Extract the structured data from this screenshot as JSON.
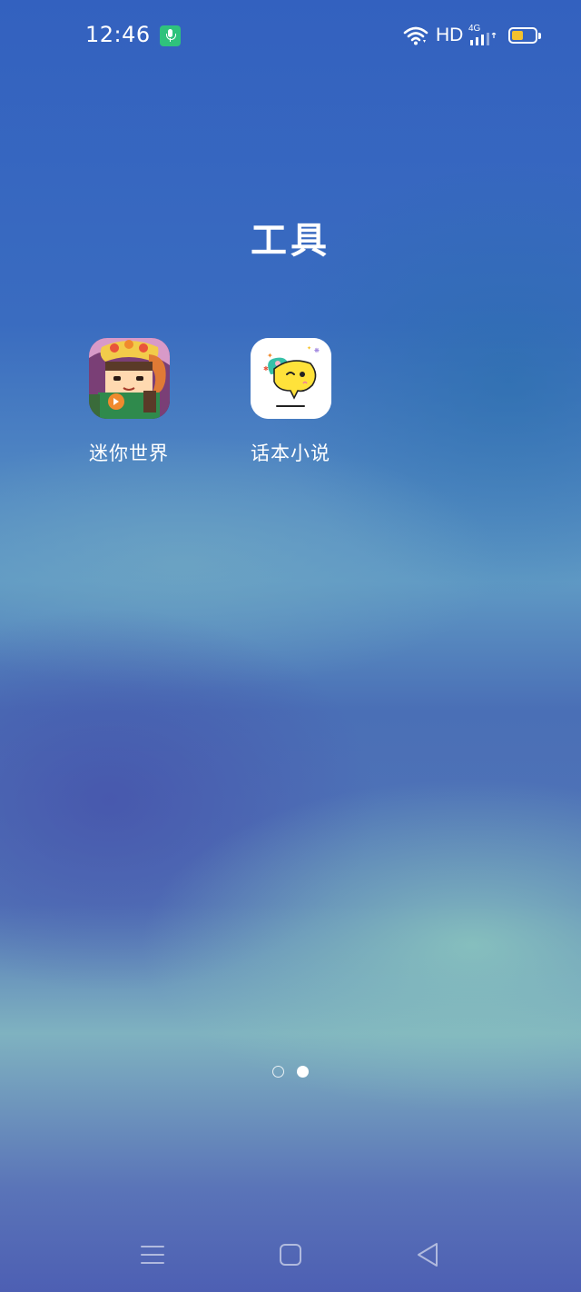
{
  "status_bar": {
    "time": "12:46",
    "network_label": "HD",
    "network_type": "4G",
    "battery_color": "#f2c12e",
    "mic_color": "#2fc27c"
  },
  "folder": {
    "title": "工具",
    "apps": [
      {
        "label": "迷你世界",
        "icon": "mini-world-game-icon"
      },
      {
        "label": "话本小说",
        "icon": "huaben-novel-chat-bubble-icon"
      }
    ]
  },
  "pager": {
    "pages": 2,
    "current_page": 2
  },
  "nav_bar": {
    "buttons": [
      "menu-icon",
      "home-icon",
      "back-icon"
    ]
  }
}
